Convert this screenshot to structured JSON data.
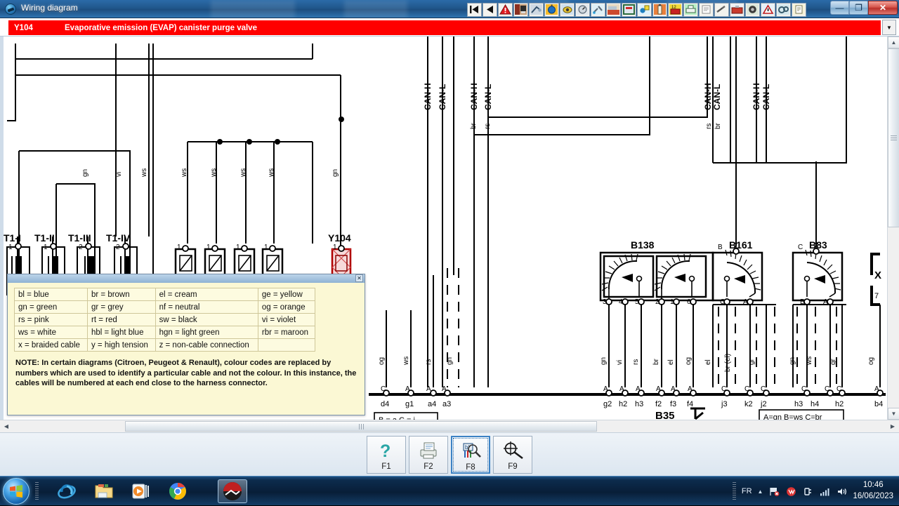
{
  "window": {
    "title": "Wiring diagram",
    "icon": "app-globe-icon",
    "minimize": "—",
    "maximize": "❐",
    "close": "✕"
  },
  "header": {
    "code": "Y104",
    "description": "Evaporative emission (EVAP) canister purge valve",
    "bar_color": "#ff0000",
    "dropdown_icon": "▼"
  },
  "toolbar": {
    "items": [
      {
        "name": "first-page-button",
        "icon": "skip-back-icon"
      },
      {
        "name": "previous-page-button",
        "icon": "back-arrow-icon"
      },
      {
        "name": "warning-button",
        "icon": "warning-triangle-icon"
      },
      {
        "name": "vehicle-door-button",
        "icon": "door-icon"
      },
      {
        "name": "wiring-tool-button",
        "icon": "wire-tool-icon"
      },
      {
        "name": "timing-button",
        "icon": "stopwatch-icon"
      },
      {
        "name": "camera-button",
        "icon": "camera-icon"
      },
      {
        "name": "gauge-button",
        "icon": "gauge-icon"
      },
      {
        "name": "tools-button",
        "icon": "tools-icon"
      },
      {
        "name": "engine-bay-button",
        "icon": "engine-bay-icon"
      },
      {
        "name": "lift-button",
        "icon": "vehicle-lift-icon"
      },
      {
        "name": "service-button",
        "icon": "service-icon"
      },
      {
        "name": "spray-button",
        "icon": "spray-can-icon"
      },
      {
        "name": "battery-button",
        "icon": "battery-icon"
      },
      {
        "name": "print-button",
        "icon": "printer-icon"
      },
      {
        "name": "document-button",
        "icon": "document-icon"
      },
      {
        "name": "ruler-button",
        "icon": "ruler-icon"
      },
      {
        "name": "toolbox-button",
        "icon": "toolbox-icon"
      },
      {
        "name": "tyre-button",
        "icon": "tyre-icon"
      },
      {
        "name": "caution-button",
        "icon": "caution-icon"
      },
      {
        "name": "belt-button",
        "icon": "belt-icon"
      },
      {
        "name": "notes-button",
        "icon": "notes-icon"
      }
    ]
  },
  "legend": {
    "title": "",
    "close_icon": "✕",
    "rows": [
      [
        "bl = blue",
        "br = brown",
        "el = cream",
        "ge = yellow"
      ],
      [
        "gn = green",
        "gr = grey",
        "nf = neutral",
        "og = orange"
      ],
      [
        "rs = pink",
        "rt = red",
        "sw = black",
        "vi = violet"
      ],
      [
        "ws = white",
        "hbl = light blue",
        "hgn = light green",
        "rbr = maroon"
      ],
      [
        "x = braided cable",
        "y = high tension",
        "z = non-cable connection",
        ""
      ]
    ],
    "note": "NOTE: In certain diagrams (Citroen, Peugeot & Renault), colour codes are replaced by numbers which are used to identify a particular cable and not the colour. In this instance, the cables will be numbered at each end close to the harness connector."
  },
  "function_keys": [
    {
      "label": "F1",
      "icon": "help-question-icon",
      "selected": false
    },
    {
      "label": "F2",
      "icon": "printer-icon",
      "selected": false
    },
    {
      "label": "F8",
      "icon": "colour-key-magnifier-icon",
      "selected": true
    },
    {
      "label": "F9",
      "icon": "zoom-target-icon",
      "selected": false
    }
  ],
  "diagram": {
    "components": [
      {
        "ref": "T1-I",
        "pins_top": [
          "1"
        ],
        "pins_bottom": [
          "2"
        ],
        "wires_top": [
          ""
        ],
        "type": "resistor"
      },
      {
        "ref": "T1-II",
        "pins_top": [
          "1"
        ],
        "pins_bottom": [
          "2"
        ],
        "wires_top": [
          ""
        ],
        "type": "resistor"
      },
      {
        "ref": "T1-III",
        "pins_top": [
          "2"
        ],
        "pins_bottom": [
          "1"
        ],
        "wires_top": [
          "gn"
        ],
        "type": "resistor"
      },
      {
        "ref": "T1-IV",
        "pins_top": [
          "2"
        ],
        "pins_bottom": [
          "1"
        ],
        "wires_top": [
          "vi"
        ],
        "type": "resistor"
      },
      {
        "ref": "",
        "pins_top": [
          "1"
        ],
        "pins_bottom": [
          "2"
        ],
        "wires_top": [
          "ws"
        ],
        "type": "injector"
      },
      {
        "ref": "",
        "pins_top": [
          "1"
        ],
        "pins_bottom": [
          "2"
        ],
        "wires_top": [
          "ws"
        ],
        "type": "injector"
      },
      {
        "ref": "",
        "pins_top": [
          "1"
        ],
        "pins_bottom": [
          "2"
        ],
        "wires_top": [
          "ws"
        ],
        "type": "injector"
      },
      {
        "ref": "",
        "pins_top": [
          "1"
        ],
        "pins_bottom": [
          "2"
        ],
        "wires_top": [
          "ws"
        ],
        "type": "injector"
      },
      {
        "ref": "Y104",
        "pins_top": [
          "1"
        ],
        "pins_bottom": [
          "2"
        ],
        "wires_top": [
          "gn"
        ],
        "type": "valve-highlighted"
      }
    ],
    "sensors": [
      {
        "ref": "B138",
        "pins": [
          "3",
          "4",
          "5",
          "2",
          "1",
          "6"
        ],
        "top_pins": []
      },
      {
        "ref": "B161",
        "pins": [
          "C",
          "A"
        ],
        "top_pins": [
          "B"
        ]
      },
      {
        "ref": "B83",
        "pins": [
          "B",
          "A"
        ],
        "top_pins": [
          "C"
        ]
      }
    ],
    "can_labels": [
      "CAN-H",
      "CAN-L",
      "CAN-H",
      "CAN-L",
      "CAN-H",
      "CAN-L",
      "CAN-H",
      "CAN-L"
    ],
    "can_wire_colours": [
      "br",
      "rs",
      "rs",
      "br"
    ],
    "connector_ground": "B35",
    "x_connector": {
      "label": "X",
      "pin": "7"
    },
    "bottom_terminals": [
      {
        "letter": "C",
        "code": "d4",
        "colour": "og"
      },
      {
        "letter": "A",
        "code": "g1",
        "colour": "ws"
      },
      {
        "letter": "A",
        "code": "a4",
        "colour": "rs"
      },
      {
        "letter": "A",
        "code": "a3",
        "colour": "gn"
      },
      {
        "letter": "A",
        "code": "g2",
        "colour": "gn"
      },
      {
        "letter": "A",
        "code": "h2",
        "colour": "vi"
      },
      {
        "letter": "A",
        "code": "h3",
        "colour": "rs"
      },
      {
        "letter": "A",
        "code": "f2",
        "colour": "br"
      },
      {
        "letter": "A",
        "code": "f3",
        "colour": "el"
      },
      {
        "letter": "A",
        "code": "f4",
        "colour": "og"
      },
      {
        "letter": "C",
        "code": "j3",
        "colour": "el"
      },
      {
        "letter": "C",
        "code": "k2",
        "colour": "br (el)"
      },
      {
        "letter": "C",
        "code": "j2",
        "colour": "gr"
      },
      {
        "letter": "C",
        "code": "h3",
        "colour": "gn"
      },
      {
        "letter": "C",
        "code": "h4",
        "colour": "ws"
      },
      {
        "letter": "C",
        "code": "h2",
        "colour": "gr"
      },
      {
        "letter": "A",
        "code": "b4",
        "colour": "og"
      }
    ],
    "highlight_colour": "#cc0000"
  },
  "taskbar": {
    "start_label": "start-orb",
    "items": [
      {
        "name": "internet-explorer-icon",
        "active": false
      },
      {
        "name": "file-explorer-icon",
        "active": false
      },
      {
        "name": "media-player-icon",
        "active": false
      },
      {
        "name": "google-chrome-icon",
        "active": false
      },
      {
        "name": "wiring-diagram-app-icon",
        "active": true
      }
    ],
    "tray": {
      "language": "FR",
      "show_hidden_icon": "▲",
      "network_icon": "network-flag-icon",
      "security_icon": "security-shield-icon",
      "power_icon": "power-plug-icon",
      "signal_icon": "signal-bars-icon",
      "volume_icon": "volume-speaker-icon",
      "time": "10:46",
      "date": "16/06/2023"
    }
  }
}
